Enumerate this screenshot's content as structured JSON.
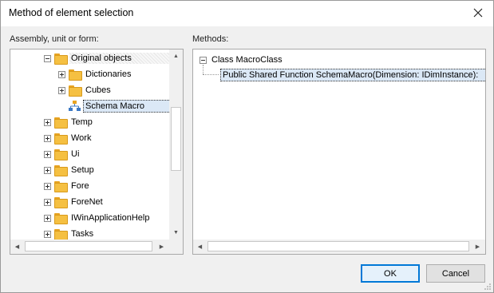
{
  "dialog": {
    "title": "Method of element selection",
    "close_icon": "close-icon"
  },
  "left_panel": {
    "label": "Assembly, unit or form:",
    "tree": [
      {
        "label": "Original objects",
        "expander": "minus",
        "level": 1,
        "style": "hatched"
      },
      {
        "label": "Dictionaries",
        "expander": "plus",
        "level": 2
      },
      {
        "label": "Cubes",
        "expander": "plus",
        "level": 2
      },
      {
        "label": "Schema Macro",
        "expander": "none",
        "level": 2,
        "style": "selected",
        "icon": "schema-macro-icon"
      },
      {
        "label": "Temp",
        "expander": "plus",
        "level": 0
      },
      {
        "label": "Work",
        "expander": "plus",
        "level": 0
      },
      {
        "label": "Ui",
        "expander": "plus",
        "level": 0
      },
      {
        "label": "Setup",
        "expander": "plus",
        "level": 0
      },
      {
        "label": "Fore",
        "expander": "plus",
        "level": 0
      },
      {
        "label": "ForeNet",
        "expander": "plus",
        "level": 0
      },
      {
        "label": "IWinApplicationHelp",
        "expander": "plus",
        "level": 0
      },
      {
        "label": "Tasks",
        "expander": "plus",
        "level": 0
      }
    ]
  },
  "right_panel": {
    "label": "Methods:",
    "class_node": "Class MacroClass",
    "method_node": "Public Shared Function SchemaMacro(Dimension: IDimInstance):"
  },
  "buttons": {
    "ok": "OK",
    "cancel": "Cancel"
  },
  "colors": {
    "folder": "#f5c042",
    "selection": "#dbe8f6",
    "default_button_border": "#0078d7"
  }
}
